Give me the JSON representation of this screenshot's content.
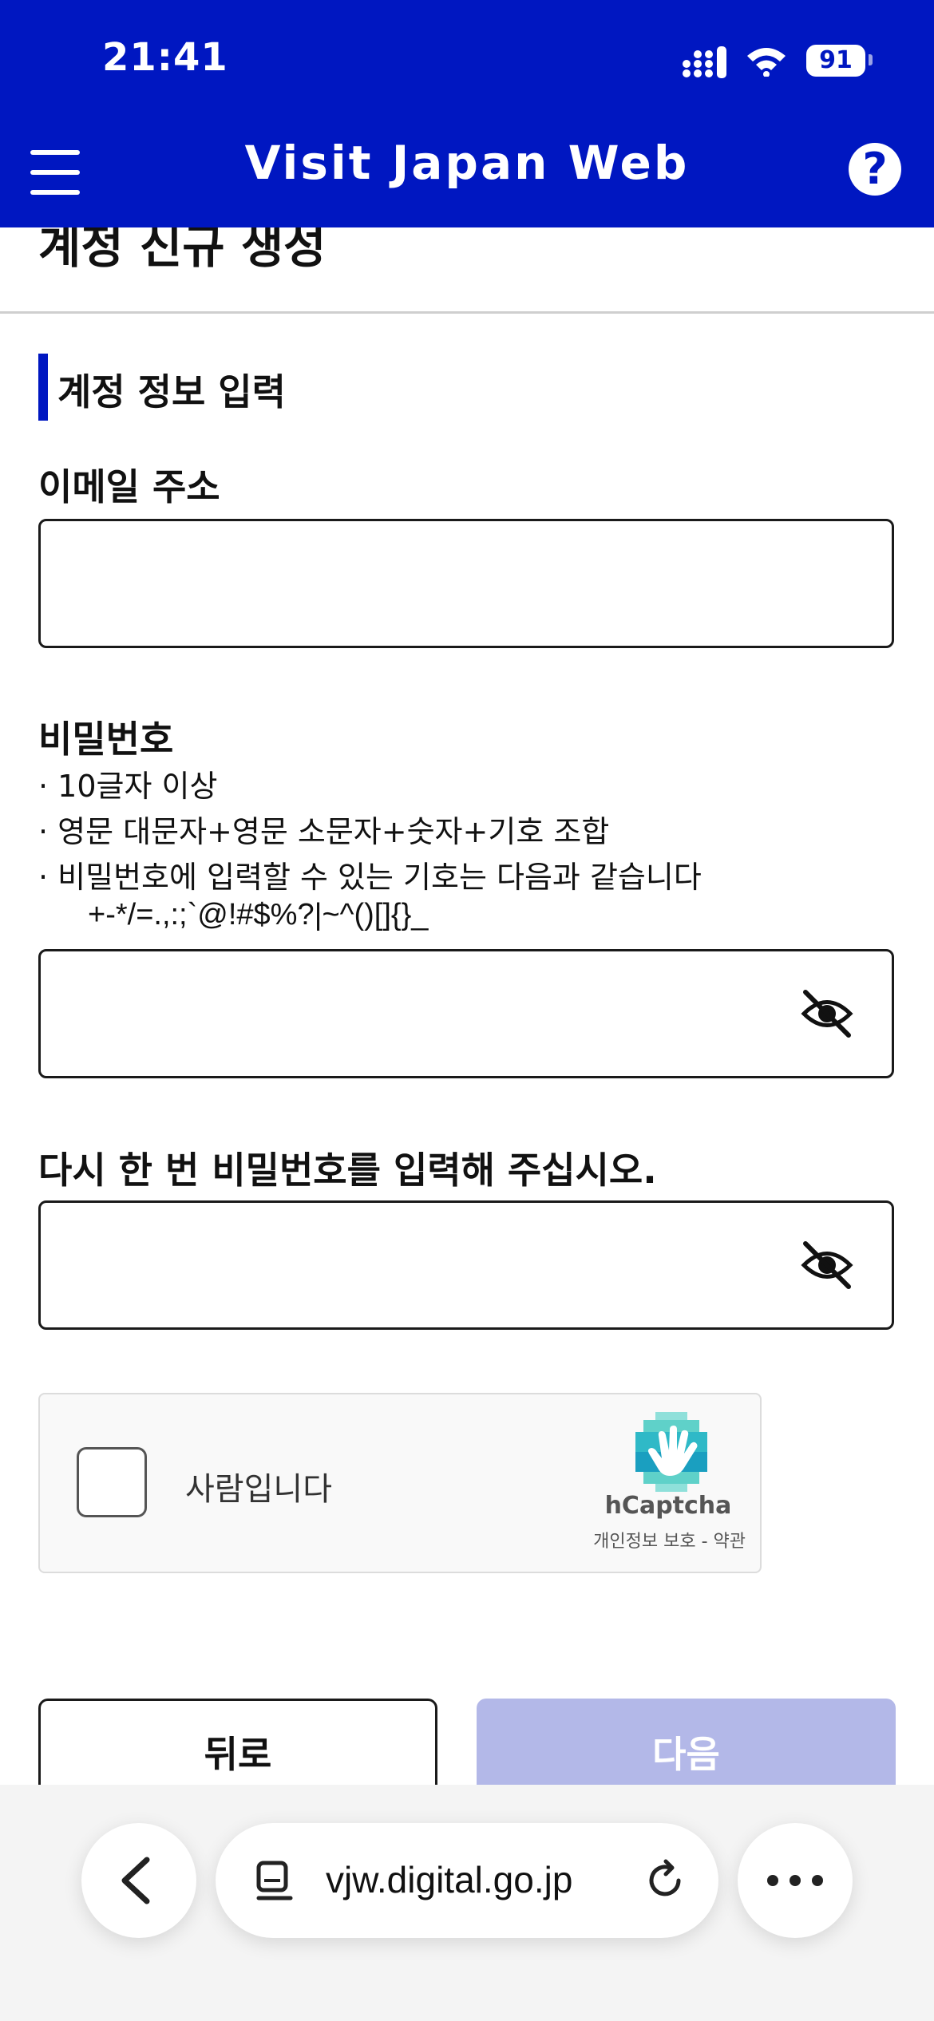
{
  "status_bar": {
    "time": "21:41",
    "battery": "91"
  },
  "header": {
    "title": "Visit Japan Web",
    "help_glyph": "?"
  },
  "page": {
    "title": "계정 신규 생성"
  },
  "section": {
    "title": "계정 정보 입력"
  },
  "email": {
    "label": "이메일 주소",
    "value": "",
    "placeholder": ""
  },
  "password": {
    "label": "비밀번호",
    "hints": [
      "· 10글자 이상",
      "· 영문 대문자+영문 소문자+숫자+기호 조합",
      "· 비밀번호에 입력할 수 있는 기호는 다음과 같습니다"
    ],
    "symbols": "+-*/=.,:;`@!#$%?|~^()[]{}_",
    "value": ""
  },
  "password_confirm": {
    "label": "다시 한 번 비밀번호를 입력해 주십시오.",
    "value": ""
  },
  "captcha": {
    "label": "사람입니다",
    "brand": "hCaptcha",
    "privacy_link": "개인정보 보호",
    "separator": " - ",
    "terms_link": "약관"
  },
  "buttons": {
    "back": "뒤로",
    "next": "다음"
  },
  "browser": {
    "url": "vjw.digital.go.jp"
  },
  "icons": {
    "menu": "hamburger-menu-icon",
    "help": "question-mark-icon",
    "eye": "eye-slash-icon",
    "captcha_logo": "hcaptcha-hand-icon",
    "back": "chevron-left-icon",
    "reader": "reader-mode-icon",
    "reload": "reload-icon",
    "more": "more-dots-icon"
  },
  "colors": {
    "brand_blue": "#0017c1",
    "disabled_button": "#b3b8e8",
    "captcha_teal": "#4ecdc4"
  }
}
